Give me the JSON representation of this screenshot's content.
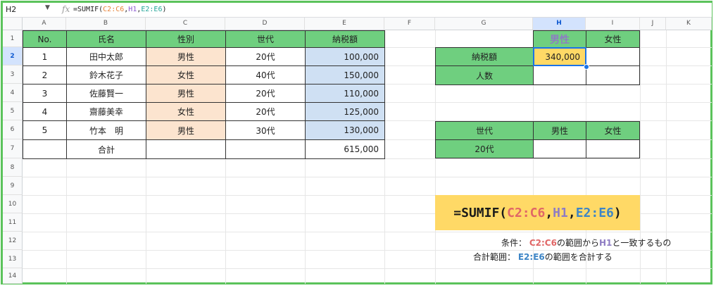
{
  "formula_bar": {
    "cell_ref": "H2",
    "fx": "fx",
    "f_prefix": "=SUMIF(",
    "f_arg1": "C2:C6",
    "f_sep1": ",",
    "f_arg2": "H1",
    "f_sep2": ",",
    "f_arg3": "E2:E6",
    "f_suffix": ")"
  },
  "columns": [
    "A",
    "B",
    "C",
    "D",
    "E",
    "F",
    "G",
    "H",
    "I",
    "J",
    "K"
  ],
  "rows": [
    "1",
    "2",
    "3",
    "4",
    "5",
    "6",
    "7",
    "8",
    "9",
    "10",
    "11",
    "12",
    "13",
    "14"
  ],
  "table": {
    "headers": [
      "No.",
      "氏名",
      "性別",
      "世代",
      "納税額"
    ],
    "rows": [
      [
        "1",
        "田中太郎",
        "男性",
        "20代",
        "100,000"
      ],
      [
        "2",
        "鈴木花子",
        "女性",
        "40代",
        "150,000"
      ],
      [
        "3",
        "佐藤賢一",
        "男性",
        "20代",
        "110,000"
      ],
      [
        "4",
        "齋藤美幸",
        "女性",
        "20代",
        "125,000"
      ],
      [
        "5",
        "竹本　明",
        "男性",
        "30代",
        "130,000"
      ]
    ],
    "total_label": "合計",
    "total_value": "615,000"
  },
  "summary1": {
    "h_male": "男性",
    "h_female": "女性",
    "row1_label": "納税額",
    "row1_male": "340,000",
    "row2_label": "人数"
  },
  "summary2": {
    "h_gen": "世代",
    "h_male": "男性",
    "h_female": "女性",
    "row1_label": "20代"
  },
  "formula_display": {
    "prefix": "=SUMIF(",
    "arg1": "C2:C6",
    "sep1": ",",
    "arg2": "H1",
    "sep2": ",",
    "arg3": "E2:E6",
    "suffix": ")"
  },
  "notes": {
    "cond_label": "条件：",
    "cond_range": "C2:C6",
    "cond_mid": "の範囲から",
    "cond_ref": "H1",
    "cond_end": "と一致するもの",
    "sum_label": "合計範囲：",
    "sum_range": "E2:E6",
    "sum_end": "の範囲を合計する"
  }
}
